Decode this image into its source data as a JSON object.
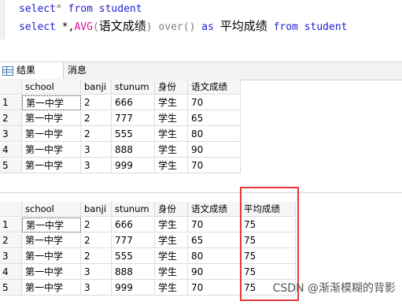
{
  "editor": {
    "line1": {
      "select": "select",
      "star": "*",
      "from": "from",
      "table": "student"
    },
    "line2": {
      "select": "select",
      "star": "*,",
      "func": "AVG",
      "open": "(",
      "col": "语文成绩",
      "close": ")",
      "over": "over()",
      "as": "as",
      "alias": "平均成绩",
      "from": "from",
      "table": "student"
    }
  },
  "tabs": {
    "results": "结果",
    "messages": "消息"
  },
  "grid1": {
    "columns": [
      "school",
      "banji",
      "stunum",
      "身份",
      "语文成绩"
    ],
    "rows": [
      {
        "n": "1",
        "cells": [
          "第一中学",
          "2",
          "666",
          "学生",
          "70"
        ]
      },
      {
        "n": "2",
        "cells": [
          "第一中学",
          "2",
          "777",
          "学生",
          "65"
        ]
      },
      {
        "n": "3",
        "cells": [
          "第一中学",
          "2",
          "555",
          "学生",
          "80"
        ]
      },
      {
        "n": "4",
        "cells": [
          "第一中学",
          "3",
          "888",
          "学生",
          "90"
        ]
      },
      {
        "n": "5",
        "cells": [
          "第一中学",
          "3",
          "999",
          "学生",
          "70"
        ]
      }
    ]
  },
  "grid2": {
    "columns": [
      "school",
      "banji",
      "stunum",
      "身份",
      "语文成绩",
      "平均成绩"
    ],
    "rows": [
      {
        "n": "1",
        "cells": [
          "第一中学",
          "2",
          "666",
          "学生",
          "70",
          "75"
        ]
      },
      {
        "n": "2",
        "cells": [
          "第一中学",
          "2",
          "777",
          "学生",
          "65",
          "75"
        ]
      },
      {
        "n": "3",
        "cells": [
          "第一中学",
          "2",
          "555",
          "学生",
          "80",
          "75"
        ]
      },
      {
        "n": "4",
        "cells": [
          "第一中学",
          "3",
          "888",
          "学生",
          "90",
          "75"
        ]
      },
      {
        "n": "5",
        "cells": [
          "第一中学",
          "3",
          "999",
          "学生",
          "70",
          "75"
        ]
      }
    ]
  },
  "watermark": "CSDN @渐渐模糊的背影",
  "colors": {
    "keyword": "#1f1fd0",
    "function": "#e0109a",
    "highlight": "#e53935"
  }
}
